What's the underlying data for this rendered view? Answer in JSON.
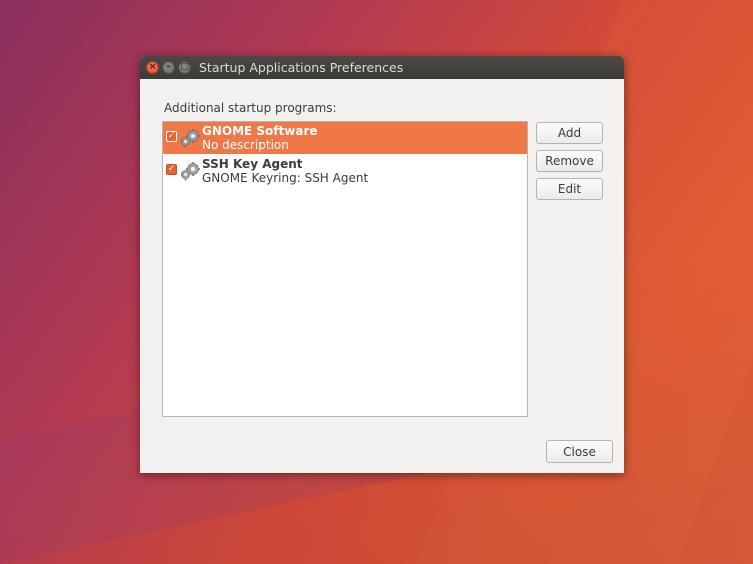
{
  "window": {
    "title": "Startup Applications Preferences",
    "controls": {
      "close_icon": "close-icon",
      "minimize_icon": "minimize-icon",
      "maximize_icon": "maximize-icon"
    }
  },
  "main": {
    "section_label": "Additional startup programs:",
    "programs": [
      {
        "name": "GNOME Software",
        "description": "No description",
        "enabled": true,
        "selected": true,
        "icon": "gears-icon"
      },
      {
        "name": "SSH Key Agent",
        "description": "GNOME Keyring: SSH Agent",
        "enabled": true,
        "selected": false,
        "icon": "gears-icon"
      }
    ]
  },
  "actions": {
    "add_label": "Add",
    "remove_label": "Remove",
    "edit_label": "Edit",
    "close_label": "Close"
  },
  "colors": {
    "accent": "#f07746",
    "titlebar": "#3c3b37",
    "window_bg": "#f2f1f0"
  }
}
